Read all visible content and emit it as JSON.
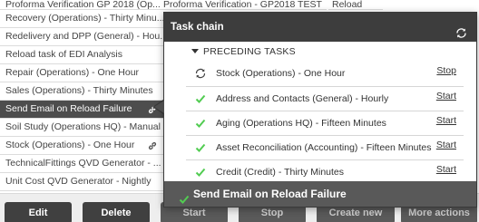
{
  "background_columns": {
    "col2_first": "Proforma Verification - GP2018 TEST",
    "col3_first": "Reload"
  },
  "tasks": [
    {
      "label": "Proforma Verification GP 2018 (Op...",
      "selected": false,
      "chain": false
    },
    {
      "label": "Recovery (Operations) - Thirty Minu...",
      "selected": false,
      "chain": false
    },
    {
      "label": "Redelivery and DPP (General) - Hou...",
      "selected": false,
      "chain": false
    },
    {
      "label": "Reload task of EDI Analysis",
      "selected": false,
      "chain": false
    },
    {
      "label": "Repair (Operations) - One Hour",
      "selected": false,
      "chain": false
    },
    {
      "label": "Sales (Operations) - Thirty Minutes",
      "selected": false,
      "chain": false
    },
    {
      "label": "Send Email on Reload Failure",
      "selected": true,
      "chain": true
    },
    {
      "label": "Soil Study (Operations HQ) - Manual",
      "selected": false,
      "chain": false
    },
    {
      "label": "Stock (Operations) - One Hour",
      "selected": false,
      "chain": true
    },
    {
      "label": "TechnicalFittings QVD Generator - ...",
      "selected": false,
      "chain": false
    },
    {
      "label": "Unit Cost QVD Generator - Nightly",
      "selected": false,
      "chain": false
    }
  ],
  "toolbar": {
    "edit_label": "Edit",
    "delete_label": "Delete",
    "start_label": "Start",
    "stop_label": "Stop",
    "create_new_label": "Create new",
    "more_actions_label": "More actions"
  },
  "popover": {
    "title": "Task chain",
    "section_title": "PRECEDING TASKS",
    "rows": [
      {
        "status": "running",
        "name": "Stock (Operations) - One Hour",
        "action": "Stop"
      },
      {
        "status": "success",
        "name": "Address and Contacts (General) - Hourly",
        "action": "Start"
      },
      {
        "status": "success",
        "name": "Aging (Operations HQ) - Fifteen Minutes",
        "action": "Start"
      },
      {
        "status": "success",
        "name": "Asset Reconciliation (Accounting) - Fifteen Minutes",
        "action": "Start"
      },
      {
        "status": "success",
        "name": "Credit (Credit) - Thirty Minutes",
        "action": "Start"
      }
    ],
    "footer_label": "Send Email on Reload Failure"
  },
  "colors": {
    "success": "#52cc52",
    "header_bg": "#3d3d3d",
    "footer_bg": "#595959",
    "selected_row": "#4d4d4d"
  }
}
